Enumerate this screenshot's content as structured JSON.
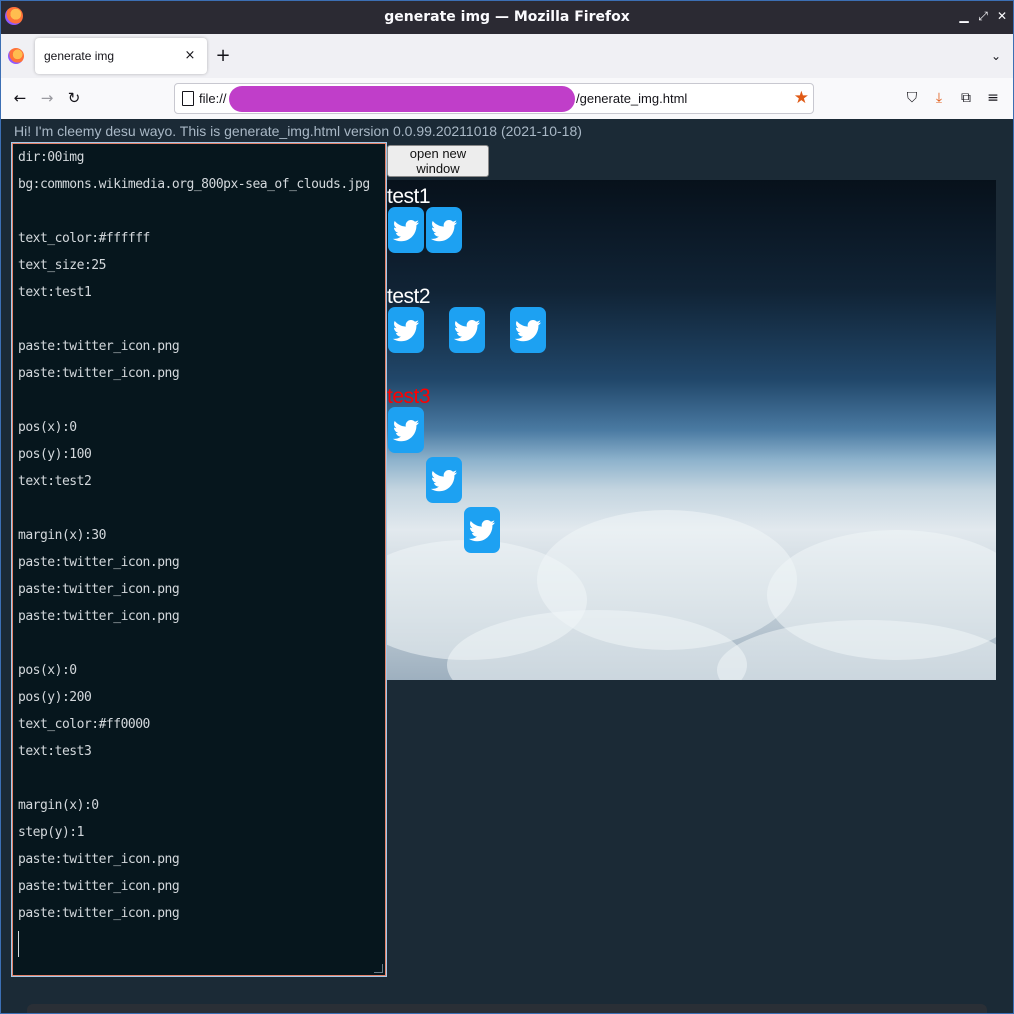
{
  "window": {
    "title": "generate img — Mozilla Firefox"
  },
  "tab": {
    "label": "generate img",
    "close": "×"
  },
  "nav": {
    "back": "←",
    "forward": "→",
    "reload": "↻",
    "new_tab": "+",
    "tab_list": "⌄"
  },
  "url": {
    "prefix": "file://",
    "suffix": "/generate_img.html"
  },
  "toolbar": {
    "pocket": "⛉",
    "download": "⤓",
    "extensions": "⧉",
    "menu": "≡"
  },
  "page": {
    "greeting": "Hi! I'm cleemy desu wayo. This is generate_img.html version 0.0.99.20211018 (2021-10-18)",
    "open_button": "open new window"
  },
  "editor": {
    "lines": [
      "dir:00img",
      "bg:commons.wikimedia.org_800px-sea_of_clouds.jpg",
      "",
      "text_color:#ffffff",
      "text_size:25",
      "text:test1",
      "",
      "paste:twitter_icon.png",
      "paste:twitter_icon.png",
      "",
      "pos(x):0",
      "pos(y):100",
      "text:test2",
      "",
      "margin(x):30",
      "paste:twitter_icon.png",
      "paste:twitter_icon.png",
      "paste:twitter_icon.png",
      "",
      "pos(x):0",
      "pos(y):200",
      "text_color:#ff0000",
      "text:test3",
      "",
      "margin(x):0",
      "step(y):1",
      "paste:twitter_icon.png",
      "paste:twitter_icon.png",
      "paste:twitter_icon.png"
    ]
  },
  "preview": {
    "texts": [
      {
        "text": "test1",
        "color": "#ffffff"
      },
      {
        "text": "test2",
        "color": "#ffffff"
      },
      {
        "text": "test3",
        "color": "#ff0000"
      }
    ],
    "icon": "twitter-icon",
    "icon_color": "#1da1f2"
  },
  "colors": {
    "accent_star": "#e05a16",
    "redaction": "#c03ec9"
  }
}
